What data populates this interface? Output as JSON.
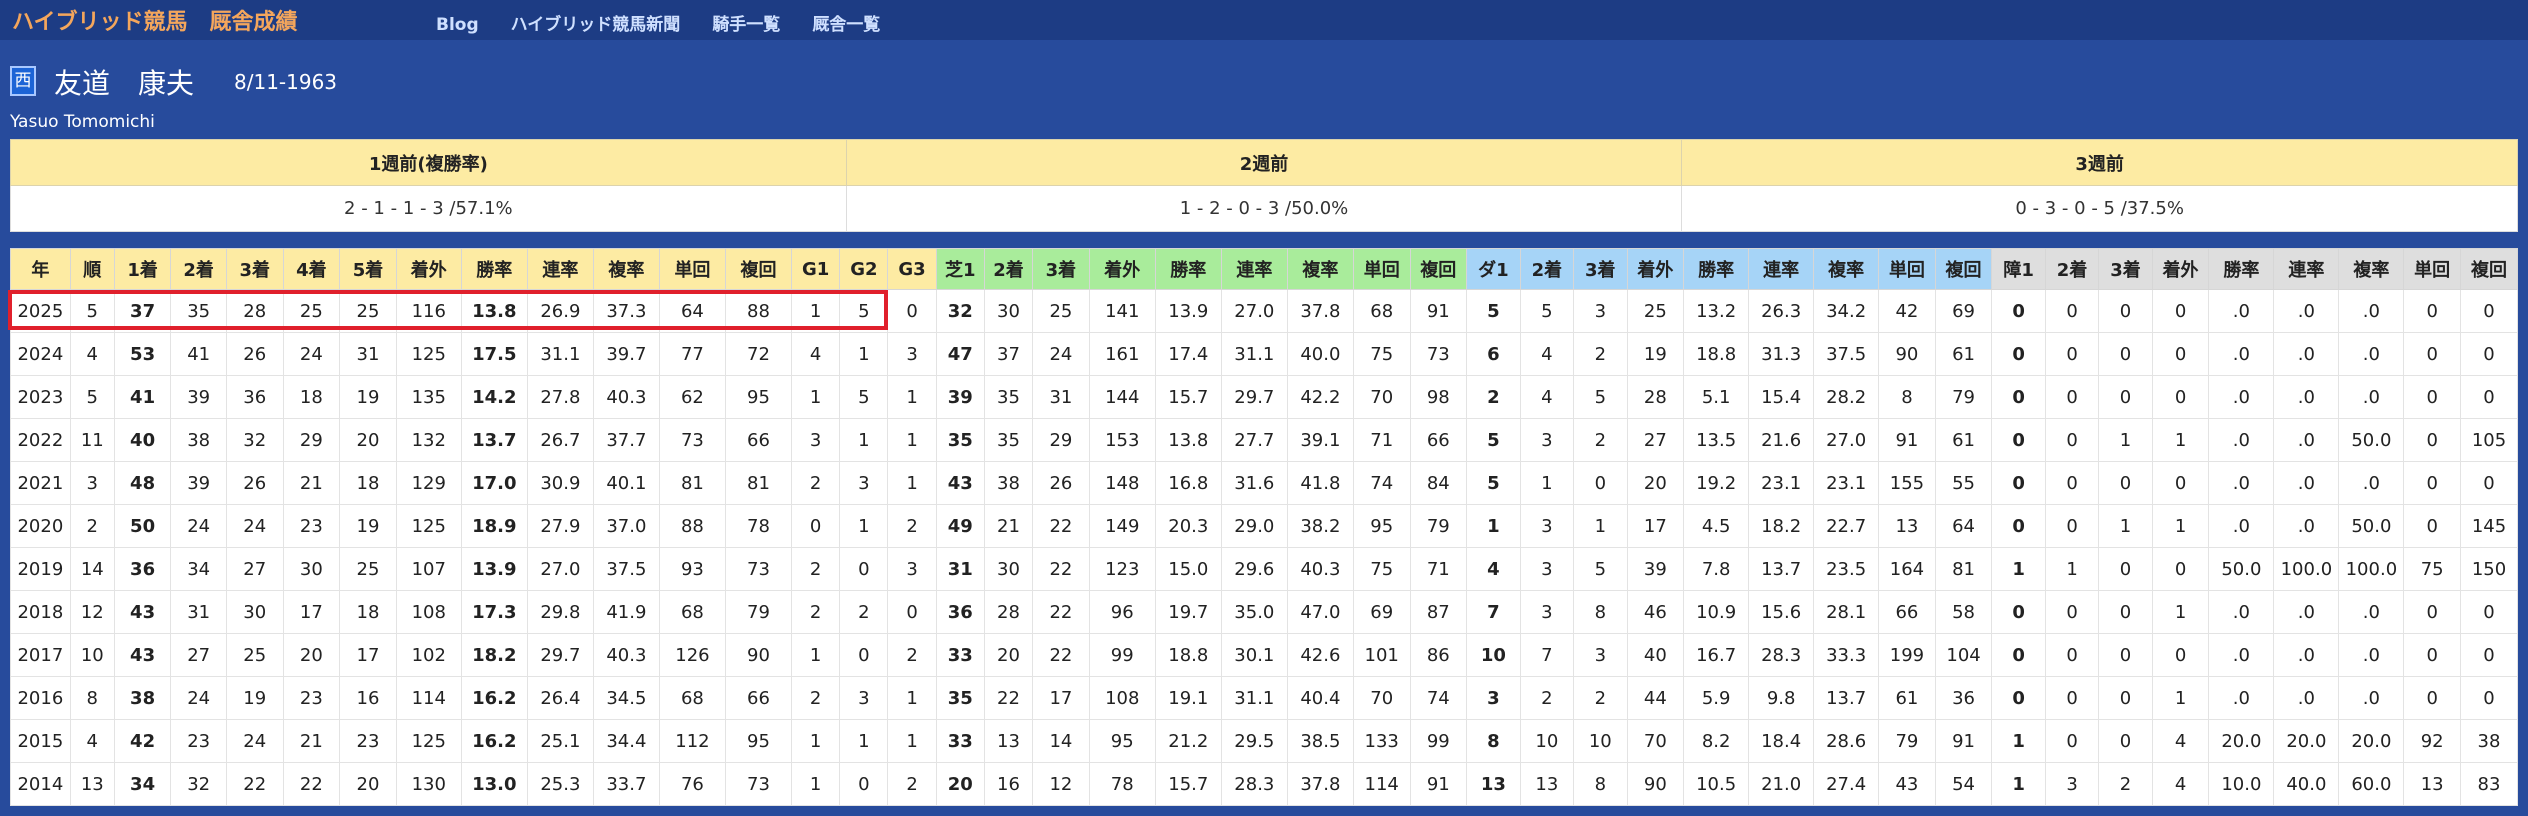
{
  "nav": {
    "brand": "ハイブリッド競馬　厩舎成績",
    "links": [
      "Blog",
      "ハイブリッド競馬新聞",
      "騎手一覧",
      "厩舎一覧"
    ]
  },
  "trainer": {
    "region_badge": "西",
    "name": "友道　康夫",
    "birthdate": "8/11-1963",
    "romaji": "Yasuo Tomomichi"
  },
  "recent": {
    "headers": [
      "1週前(複勝率)",
      "2週前",
      "3週前"
    ],
    "values": [
      "2 - 1 - 1 - 3 /57.1%",
      "1 - 2 - 0 - 3 /50.0%",
      "0 - 3 - 0 - 5 /37.5%"
    ]
  },
  "stats": {
    "headers": [
      "年",
      "順",
      "1着",
      "2着",
      "3着",
      "4着",
      "5着",
      "着外",
      "勝率",
      "連率",
      "複率",
      "単回",
      "複回",
      "G1",
      "G2",
      "G3",
      "芝1",
      "2着",
      "3着",
      "着外",
      "勝率",
      "連率",
      "複率",
      "単回",
      "複回",
      "ダ1",
      "2着",
      "3着",
      "着外",
      "勝率",
      "連率",
      "複率",
      "単回",
      "複回",
      "障1",
      "2着",
      "3着",
      "着外",
      "勝率",
      "連率",
      "複率",
      "単回",
      "複回"
    ],
    "rows": [
      [
        "2025",
        "5",
        "37",
        "35",
        "28",
        "25",
        "25",
        "116",
        "13.8",
        "26.9",
        "37.3",
        "64",
        "88",
        "1",
        "5",
        "0",
        "32",
        "30",
        "25",
        "141",
        "13.9",
        "27.0",
        "37.8",
        "68",
        "91",
        "5",
        "5",
        "3",
        "25",
        "13.2",
        "26.3",
        "34.2",
        "42",
        "69",
        "0",
        "0",
        "0",
        "0",
        ".0",
        ".0",
        ".0",
        "0",
        "0"
      ],
      [
        "2024",
        "4",
        "53",
        "41",
        "26",
        "24",
        "31",
        "125",
        "17.5",
        "31.1",
        "39.7",
        "77",
        "72",
        "4",
        "1",
        "3",
        "47",
        "37",
        "24",
        "161",
        "17.4",
        "31.1",
        "40.0",
        "75",
        "73",
        "6",
        "4",
        "2",
        "19",
        "18.8",
        "31.3",
        "37.5",
        "90",
        "61",
        "0",
        "0",
        "0",
        "0",
        ".0",
        ".0",
        ".0",
        "0",
        "0"
      ],
      [
        "2023",
        "5",
        "41",
        "39",
        "36",
        "18",
        "19",
        "135",
        "14.2",
        "27.8",
        "40.3",
        "62",
        "95",
        "1",
        "5",
        "1",
        "39",
        "35",
        "31",
        "144",
        "15.7",
        "29.7",
        "42.2",
        "70",
        "98",
        "2",
        "4",
        "5",
        "28",
        "5.1",
        "15.4",
        "28.2",
        "8",
        "79",
        "0",
        "0",
        "0",
        "0",
        ".0",
        ".0",
        ".0",
        "0",
        "0"
      ],
      [
        "2022",
        "11",
        "40",
        "38",
        "32",
        "29",
        "20",
        "132",
        "13.7",
        "26.7",
        "37.7",
        "73",
        "66",
        "3",
        "1",
        "1",
        "35",
        "35",
        "29",
        "153",
        "13.8",
        "27.7",
        "39.1",
        "71",
        "66",
        "5",
        "3",
        "2",
        "27",
        "13.5",
        "21.6",
        "27.0",
        "91",
        "61",
        "0",
        "0",
        "1",
        "1",
        ".0",
        ".0",
        "50.0",
        "0",
        "105"
      ],
      [
        "2021",
        "3",
        "48",
        "39",
        "26",
        "21",
        "18",
        "129",
        "17.0",
        "30.9",
        "40.1",
        "81",
        "81",
        "2",
        "3",
        "1",
        "43",
        "38",
        "26",
        "148",
        "16.8",
        "31.6",
        "41.8",
        "74",
        "84",
        "5",
        "1",
        "0",
        "20",
        "19.2",
        "23.1",
        "23.1",
        "155",
        "55",
        "0",
        "0",
        "0",
        "0",
        ".0",
        ".0",
        ".0",
        "0",
        "0"
      ],
      [
        "2020",
        "2",
        "50",
        "24",
        "24",
        "23",
        "19",
        "125",
        "18.9",
        "27.9",
        "37.0",
        "88",
        "78",
        "0",
        "1",
        "2",
        "49",
        "21",
        "22",
        "149",
        "20.3",
        "29.0",
        "38.2",
        "95",
        "79",
        "1",
        "3",
        "1",
        "17",
        "4.5",
        "18.2",
        "22.7",
        "13",
        "64",
        "0",
        "0",
        "1",
        "1",
        ".0",
        ".0",
        "50.0",
        "0",
        "145"
      ],
      [
        "2019",
        "14",
        "36",
        "34",
        "27",
        "30",
        "25",
        "107",
        "13.9",
        "27.0",
        "37.5",
        "93",
        "73",
        "2",
        "0",
        "3",
        "31",
        "30",
        "22",
        "123",
        "15.0",
        "29.6",
        "40.3",
        "75",
        "71",
        "4",
        "3",
        "5",
        "39",
        "7.8",
        "13.7",
        "23.5",
        "164",
        "81",
        "1",
        "1",
        "0",
        "0",
        "50.0",
        "100.0",
        "100.0",
        "75",
        "150"
      ],
      [
        "2018",
        "12",
        "43",
        "31",
        "30",
        "17",
        "18",
        "108",
        "17.3",
        "29.8",
        "41.9",
        "68",
        "79",
        "2",
        "2",
        "0",
        "36",
        "28",
        "22",
        "96",
        "19.7",
        "35.0",
        "47.0",
        "69",
        "87",
        "7",
        "3",
        "8",
        "46",
        "10.9",
        "15.6",
        "28.1",
        "66",
        "58",
        "0",
        "0",
        "0",
        "1",
        ".0",
        ".0",
        ".0",
        "0",
        "0"
      ],
      [
        "2017",
        "10",
        "43",
        "27",
        "25",
        "20",
        "17",
        "102",
        "18.2",
        "29.7",
        "40.3",
        "126",
        "90",
        "1",
        "0",
        "2",
        "33",
        "20",
        "22",
        "99",
        "18.8",
        "30.1",
        "42.6",
        "101",
        "86",
        "10",
        "7",
        "3",
        "40",
        "16.7",
        "28.3",
        "33.3",
        "199",
        "104",
        "0",
        "0",
        "0",
        "0",
        ".0",
        ".0",
        ".0",
        "0",
        "0"
      ],
      [
        "2016",
        "8",
        "38",
        "24",
        "19",
        "23",
        "16",
        "114",
        "16.2",
        "26.4",
        "34.5",
        "68",
        "66",
        "2",
        "3",
        "1",
        "35",
        "22",
        "17",
        "108",
        "19.1",
        "31.1",
        "40.4",
        "70",
        "74",
        "3",
        "2",
        "2",
        "44",
        "5.9",
        "9.8",
        "13.7",
        "61",
        "36",
        "0",
        "0",
        "0",
        "1",
        ".0",
        ".0",
        ".0",
        "0",
        "0"
      ],
      [
        "2015",
        "4",
        "42",
        "23",
        "24",
        "21",
        "23",
        "125",
        "16.2",
        "25.1",
        "34.4",
        "112",
        "95",
        "1",
        "1",
        "1",
        "33",
        "13",
        "14",
        "95",
        "21.2",
        "29.5",
        "38.5",
        "133",
        "99",
        "8",
        "10",
        "10",
        "70",
        "8.2",
        "18.4",
        "28.6",
        "79",
        "91",
        "1",
        "0",
        "0",
        "4",
        "20.0",
        "20.0",
        "20.0",
        "92",
        "38"
      ],
      [
        "2014",
        "13",
        "34",
        "32",
        "22",
        "22",
        "20",
        "130",
        "13.0",
        "25.3",
        "33.7",
        "76",
        "73",
        "1",
        "0",
        "2",
        "20",
        "16",
        "12",
        "78",
        "15.7",
        "28.3",
        "37.8",
        "114",
        "91",
        "13",
        "13",
        "8",
        "90",
        "10.5",
        "21.0",
        "27.4",
        "43",
        "54",
        "1",
        "3",
        "2",
        "4",
        "10.0",
        "40.0",
        "60.0",
        "13",
        "83"
      ]
    ]
  }
}
